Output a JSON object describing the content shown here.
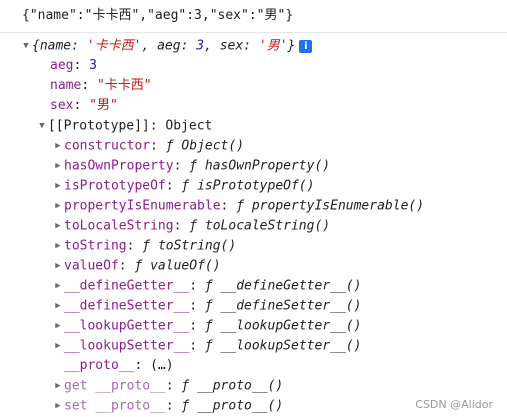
{
  "log_text": "{\"name\":\"卡卡西\",\"aeg\":3,\"sex\":\"男\"}",
  "preview": {
    "open": "{",
    "k1": "name",
    "v1": "'卡卡西'",
    "k2": "aeg",
    "v2": "3",
    "k3": "sex",
    "v3": "'男'",
    "close": "}"
  },
  "props": [
    {
      "key": "aeg",
      "value": "3",
      "kind": "num"
    },
    {
      "key": "name",
      "value": "\"卡卡西\"",
      "kind": "str"
    },
    {
      "key": "sex",
      "value": "\"男\"",
      "kind": "str"
    }
  ],
  "prototype_label": "[[Prototype]]",
  "prototype_value": "Object",
  "methods": [
    {
      "key": "constructor",
      "value": "Object()"
    },
    {
      "key": "hasOwnProperty",
      "value": "hasOwnProperty()"
    },
    {
      "key": "isPrototypeOf",
      "value": "isPrototypeOf()"
    },
    {
      "key": "propertyIsEnumerable",
      "value": "propertyIsEnumerable()"
    },
    {
      "key": "toLocaleString",
      "value": "toLocaleString()"
    },
    {
      "key": "toString",
      "value": "toString()"
    },
    {
      "key": "valueOf",
      "value": "valueOf()"
    },
    {
      "key": "__defineGetter__",
      "value": "__defineGetter__()"
    },
    {
      "key": "__defineSetter__",
      "value": "__defineSetter__()"
    },
    {
      "key": "__lookupGetter__",
      "value": "__lookupGetter__()"
    },
    {
      "key": "__lookupSetter__",
      "value": "__lookupSetter__()"
    }
  ],
  "f_symbol": "ƒ",
  "proto_line": {
    "key": "__proto__",
    "value": "(…)"
  },
  "get_proto": {
    "prefix": "get",
    "key": "__proto__",
    "value": "__proto__()"
  },
  "set_proto": {
    "prefix": "set",
    "key": "__proto__",
    "value": "__proto__()"
  },
  "watermark": "CSDN @Alidor",
  "colors": {
    "key": "#8a1e8a",
    "string": "#c41a16",
    "number": "#1a1aa6",
    "info": "#1a73e8"
  }
}
